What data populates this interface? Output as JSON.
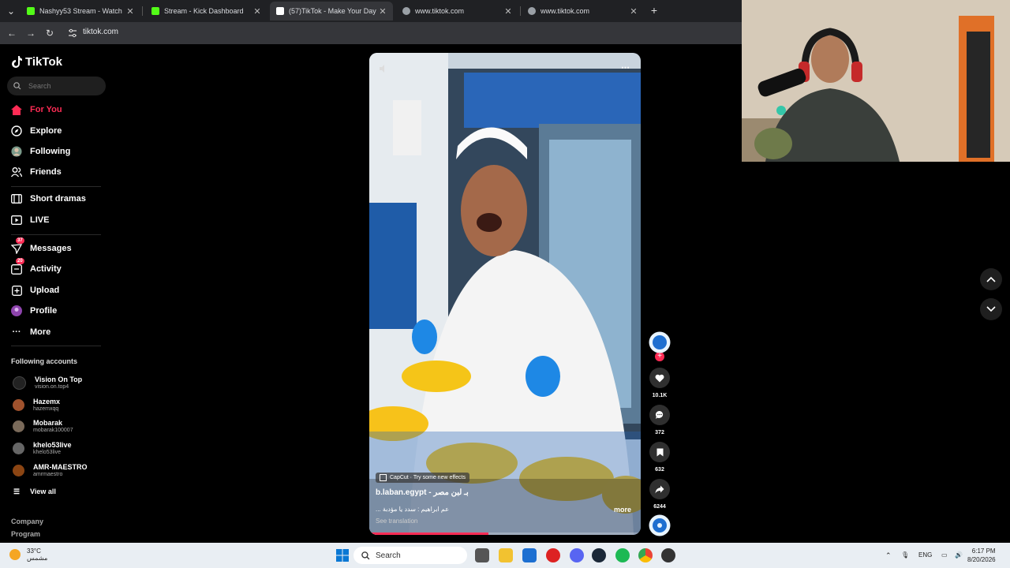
{
  "browser": {
    "tabs": [
      {
        "title": "Nashyy53 Stream - Watch Live...",
        "favicon_color": "#53fc18",
        "active": false
      },
      {
        "title": "Stream - Kick Dashboard",
        "favicon_color": "#53fc18",
        "active": false
      },
      {
        "title": "(57)TikTok - Make Your Day",
        "favicon_color": "#ffffff",
        "active": true
      },
      {
        "title": "www.tiktok.com",
        "favicon_color": "#9aa0a6",
        "active": false
      },
      {
        "title": "www.tiktok.com",
        "favicon_color": "#9aa0a6",
        "active": false
      }
    ],
    "url": "tiktok.com"
  },
  "sidebar": {
    "logo": "TikTok",
    "search_placeholder": "Search",
    "nav": [
      {
        "label": "For You",
        "icon": "home-icon",
        "active": true
      },
      {
        "label": "Explore",
        "icon": "compass-icon"
      },
      {
        "label": "Following",
        "icon": "following-avatar-icon"
      },
      {
        "label": "Friends",
        "icon": "friends-icon"
      },
      {
        "label": "Short dramas",
        "icon": "film-icon"
      },
      {
        "label": "LIVE",
        "icon": "live-icon"
      },
      {
        "label": "Messages",
        "icon": "messages-icon",
        "badge": "37"
      },
      {
        "label": "Activity",
        "icon": "activity-icon",
        "badge": "20"
      },
      {
        "label": "Upload",
        "icon": "upload-icon"
      },
      {
        "label": "Profile",
        "icon": "profile-icon"
      },
      {
        "label": "More",
        "icon": "more-icon"
      }
    ],
    "following_title": "Following accounts",
    "accounts": [
      {
        "name": "Vision On Top",
        "handle": "vision.on.top4",
        "color": "#222"
      },
      {
        "name": "Hazemx",
        "handle": "hazemxqq",
        "color": "#a0522d"
      },
      {
        "name": "Mobarak",
        "handle": "mobarak100007",
        "color": "#7a6a5a"
      },
      {
        "name": "khelo53live",
        "handle": "khelo53live",
        "color": "#666"
      },
      {
        "name": "AMR-MAESTRO",
        "handle": "amrmaestro",
        "color": "#8b4513"
      }
    ],
    "view_all": "View all",
    "footer": [
      "Company",
      "Program"
    ]
  },
  "video": {
    "capcut": "CapCut · Try some new effects",
    "caption": "b.laban.egypt - بـ لبن مصر",
    "description": "... عم ابراهيم : سدد يا مؤدبة",
    "more": "more",
    "see_translation": "See translation",
    "progress_fraction": 0.44
  },
  "actions": {
    "likes": "10.1K",
    "comments": "372",
    "saves": "632",
    "shares": "6244"
  },
  "taskbar": {
    "temp": "33°C",
    "weather": "مشمس",
    "search": "Search",
    "lang": "ENG",
    "time": "6:17 PM",
    "date": "8/20/2026"
  },
  "colors": {
    "accent": "#fe2c55",
    "bg": "#000000"
  }
}
